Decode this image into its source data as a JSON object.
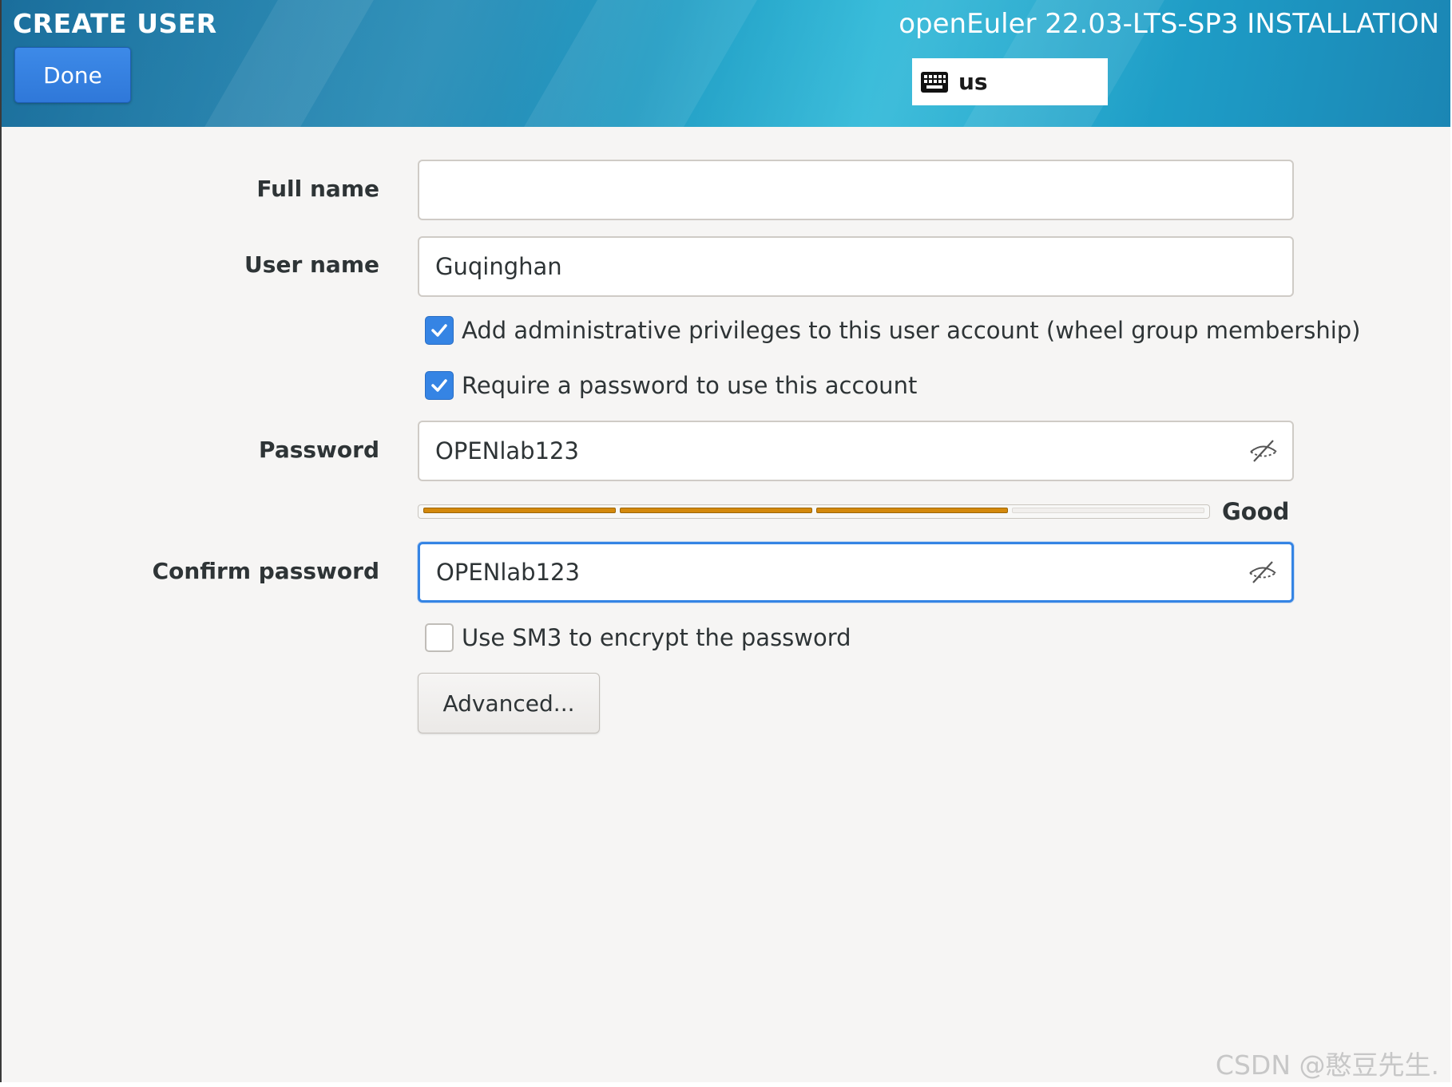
{
  "header": {
    "title": "CREATE USER",
    "done_label": "Done",
    "product": "openEuler 22.03-LTS-SP3 INSTALLATION",
    "keyboard_layout": "us",
    "keyboard_icon": "keyboard-icon"
  },
  "form": {
    "full_name": {
      "label": "Full name",
      "value": ""
    },
    "user_name": {
      "label": "User name",
      "value": "Guqinghan"
    },
    "admin_checkbox": {
      "label": "Add administrative privileges to this user account (wheel group membership)",
      "checked": true
    },
    "require_password_checkbox": {
      "label": "Require a password to use this account",
      "checked": true
    },
    "password": {
      "label": "Password",
      "value": "OPENlab123",
      "reveal_icon": "eye-slash-icon"
    },
    "strength": {
      "label": "Good",
      "level": 0.75,
      "segments_filled": 3,
      "segments_total": 4
    },
    "confirm_password": {
      "label": "Confirm password",
      "value": "OPENlab123",
      "reveal_icon": "eye-slash-icon"
    },
    "sm3_checkbox": {
      "label": "Use SM3 to encrypt the password",
      "checked": false
    },
    "advanced_label": "Advanced..."
  },
  "watermark": "CSDN @憨豆先生.",
  "colors": {
    "accent": "#3584e4",
    "done_button": "#2f78d9",
    "strength_fill": "#d4890c",
    "header_cyan": "#24b5d6"
  }
}
